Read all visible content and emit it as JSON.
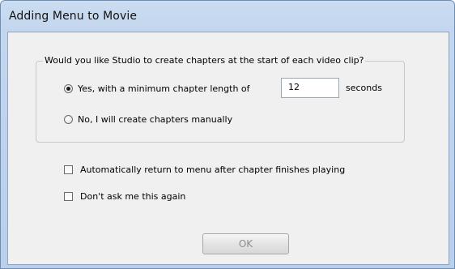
{
  "window": {
    "title": "Adding Menu to Movie"
  },
  "chapters_group": {
    "legend": "Would you like Studio to create chapters at the start of each video clip?",
    "option_auto": {
      "label": "Yes, with a minimum chapter length of",
      "selected": true
    },
    "min_length": {
      "value": "12",
      "unit_label": "seconds"
    },
    "option_manual": {
      "label": "No, I will create chapters manually",
      "selected": false
    }
  },
  "options": {
    "auto_return": {
      "label": "Automatically return to menu after chapter finishes playing",
      "checked": false
    },
    "dont_ask": {
      "label": "Don't ask me this again",
      "checked": false
    }
  },
  "buttons": {
    "ok_label": "OK"
  }
}
